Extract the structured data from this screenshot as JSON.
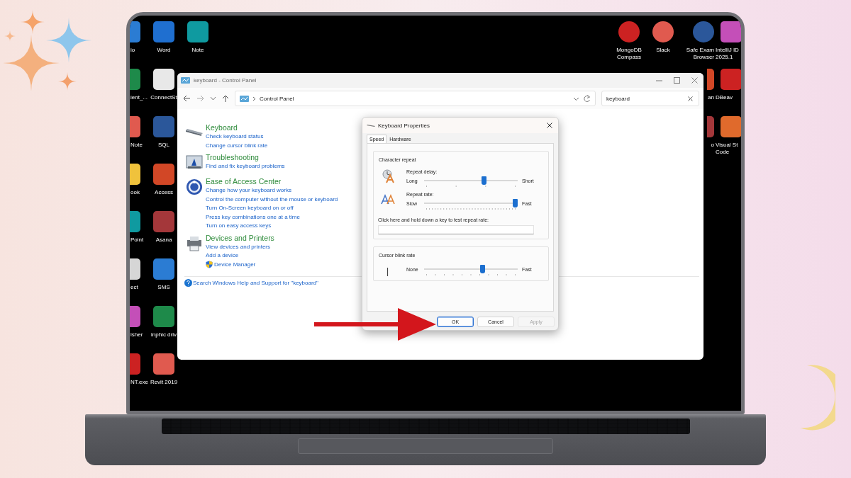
{
  "desktop": {
    "left_columns": [
      [
        "io",
        "ient_...",
        "Note",
        "ook",
        "Point",
        "ect",
        "isher",
        "NT.exe"
      ],
      [
        "Word",
        "ConnectSt",
        "SQL",
        "Access",
        "Asana",
        "SMS",
        "inphic driv",
        "Revit 2019"
      ],
      [
        "Note"
      ]
    ],
    "right_columns": [
      [
        "MongoDB Compass"
      ],
      [
        "Slack"
      ],
      [
        "Safe Exam Browser",
        "an",
        "o"
      ],
      [
        "IntelliJ ID 2025.1",
        "DBeav",
        "Visual St Code"
      ]
    ]
  },
  "control_panel": {
    "title": "keyboard - Control Panel",
    "address": {
      "location": "Control Panel"
    },
    "search": {
      "value": "keyboard"
    },
    "sections": [
      {
        "title": "Keyboard",
        "links": [
          {
            "text": "Check keyboard status",
            "shield": false
          },
          {
            "text": "Change cursor blink rate",
            "shield": false
          }
        ]
      },
      {
        "title": "Troubleshooting",
        "links": [
          {
            "text": "Find and fix keyboard problems",
            "shield": false
          }
        ]
      },
      {
        "title": "Ease of Access Center",
        "links": [
          {
            "text": "Change how your keyboard works",
            "shield": false
          },
          {
            "text": "Control the computer without the mouse or keyboard",
            "shield": false
          },
          {
            "text": "Turn On-Screen keyboard on or off",
            "shield": false
          },
          {
            "text": "Press key combinations one at a time",
            "shield": false
          },
          {
            "text": "Turn on easy access keys",
            "shield": false
          }
        ]
      },
      {
        "title": "Devices and Printers",
        "links": [
          {
            "text": "View devices and printers",
            "shield": false
          },
          {
            "text": "Add a device",
            "shield": false
          },
          {
            "text": "Device Manager",
            "shield": true
          }
        ]
      }
    ],
    "help_link": "Search Windows Help and Support for \"keyboard\""
  },
  "dialog": {
    "title": "Keyboard Properties",
    "tabs": [
      {
        "label": "Speed",
        "selected": true
      },
      {
        "label": "Hardware",
        "selected": false
      }
    ],
    "groups": [
      {
        "title": "Character repeat",
        "sliders": [
          {
            "label": "Repeat delay:",
            "min_label": "Long",
            "max_label": "Short",
            "level": 0.65
          },
          {
            "label": "Repeat rate:",
            "min_label": "Slow",
            "max_label": "Fast",
            "level": 1.0
          }
        ],
        "test_prompt": "Click here and hold down a key to test repeat rate:"
      },
      {
        "title": "Cursor blink rate",
        "sliders": [
          {
            "min_label": "None",
            "max_label": "Fast",
            "level": 0.63
          }
        ]
      }
    ],
    "buttons": [
      {
        "label": "OK",
        "default": true,
        "disabled": false
      },
      {
        "label": "Cancel",
        "default": false,
        "disabled": false
      },
      {
        "label": "Apply",
        "default": false,
        "disabled": true
      }
    ]
  }
}
